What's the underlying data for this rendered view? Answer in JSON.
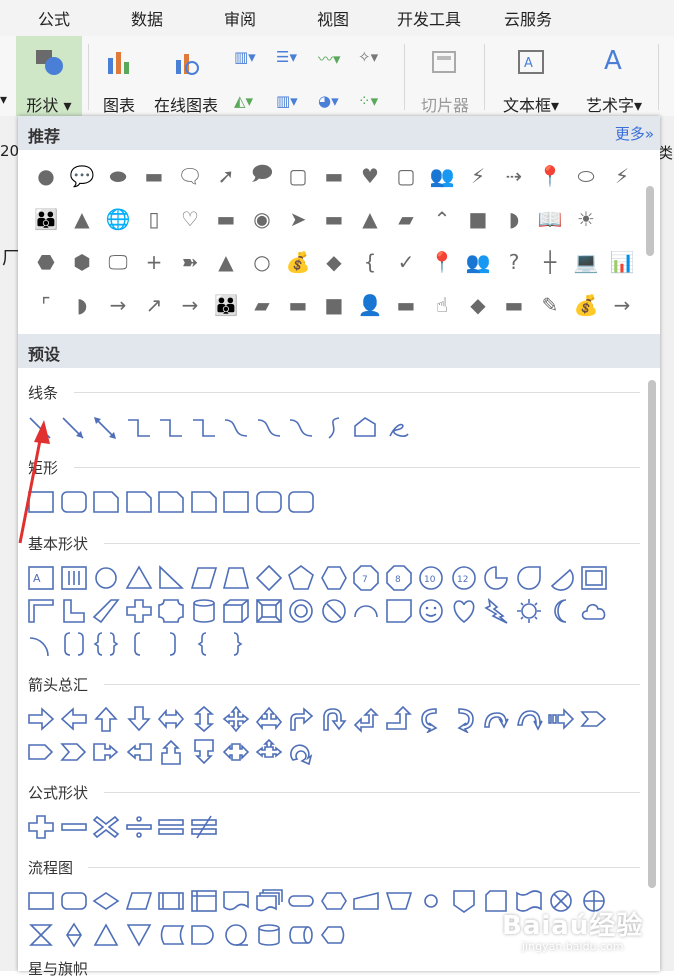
{
  "menubar": {
    "items": [
      "公式",
      "数据",
      "审阅",
      "视图",
      "开发工具",
      "云服务"
    ]
  },
  "ribbon": {
    "shape_label": "形状",
    "chart_label": "图表",
    "online_chart_label": "在线图表",
    "slicer_label": "切片器",
    "textbox_label": "文本框",
    "wordart_label": "艺术字",
    "left_edge_text": "20",
    "right_edge_text": "类",
    "sheet_char": "厂"
  },
  "panel": {
    "recommended_title": "推荐",
    "more_label": "更多»",
    "preset_title": "预设",
    "categories": {
      "lines": "线条",
      "rect": "矩形",
      "basic": "基本形状",
      "arrows": "箭头总汇",
      "formula": "公式形状",
      "flowchart": "流程图",
      "stars": "星与旗帜"
    }
  },
  "watermark": {
    "main": "Baiaú经验",
    "sub": "jingyan.baidu.com"
  },
  "colors": {
    "accent": "#3a6fd8",
    "shape_outline": "#4f6fb8",
    "recommended_fill": "#6a6a6a",
    "selected_ribbon": "#cfe6c7",
    "annotation_arrow": "#e03030"
  }
}
